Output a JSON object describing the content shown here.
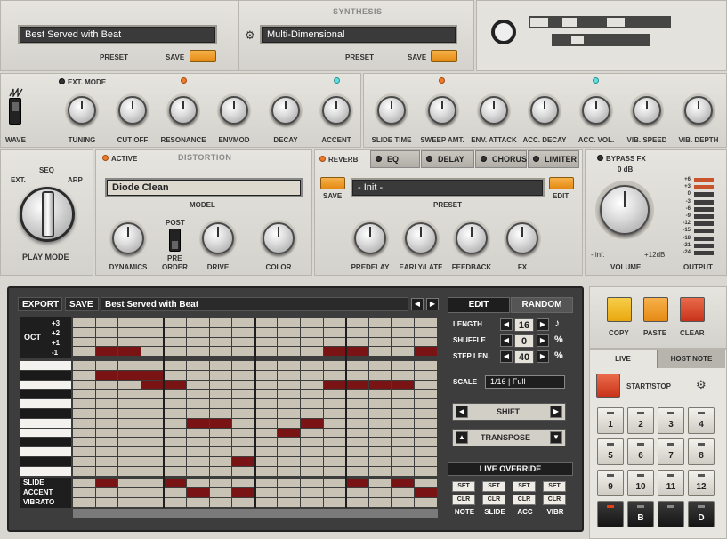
{
  "top": {
    "preset_name": "Best Served with Beat",
    "preset_label": "PRESET",
    "save_label": "SAVE",
    "synthesis_title": "SYNTHESIS",
    "synth_preset_name": "Multi-Dimensional",
    "synth_preset_label": "PRESET",
    "synth_save_label": "SAVE"
  },
  "synth_row": {
    "ext_mode": "EXT. MODE",
    "wave": "WAVE",
    "knobs": [
      "TUNING",
      "CUT OFF",
      "RESONANCE",
      "ENVMOD",
      "DECAY",
      "ACCENT",
      "SLIDE TIME",
      "SWEEP AMT.",
      "ENV. ATTACK",
      "ACC. DECAY",
      "ACC. VOL.",
      "VIB. SPEED",
      "VIB. DEPTH"
    ]
  },
  "play_mode": {
    "options": [
      "EXT.",
      "SEQ",
      "ARP"
    ],
    "label": "PLAY MODE"
  },
  "distortion": {
    "active_label": "ACTIVE",
    "title": "DISTORTION",
    "model_value": "Diode Clean",
    "model_label": "MODEL",
    "post": "POST",
    "pre": "PRE",
    "order": "ORDER",
    "knobs": [
      "DYNAMICS",
      "DRIVE",
      "COLOR"
    ]
  },
  "fx": {
    "tabs": [
      "REVERB",
      "EQ",
      "DELAY",
      "CHORUS",
      "LIMITER"
    ],
    "save_label": "SAVE",
    "preset_value": "- Init -",
    "preset_label": "PRESET",
    "edit_label": "EDIT",
    "knobs": [
      "PREDELAY",
      "EARLY/LATE",
      "FEEDBACK",
      "FX"
    ]
  },
  "output": {
    "bypass": "BYPASS FX",
    "zero_db": "0 dB",
    "minus_inf": "- inf.",
    "plus12": "+12dB",
    "volume": "VOLUME",
    "output": "OUTPUT",
    "meter": [
      "+6",
      "+3",
      "0",
      "-3",
      "-6",
      "-9",
      "-12",
      "-15",
      "-18",
      "-21",
      "-24"
    ]
  },
  "sequencer": {
    "export": "EXPORT",
    "save": "SAVE",
    "pattern_name": "Best Served with Beat",
    "edit": "EDIT",
    "random": "RANDOM",
    "length_label": "LENGTH",
    "length_value": "16",
    "shuffle_label": "SHUFFLE",
    "shuffle_value": "0",
    "shuffle_unit": "%",
    "steplen_label": "STEP LEN.",
    "steplen_value": "40",
    "steplen_unit": "%",
    "scale_label": "SCALE",
    "scale_value": "1/16 | Full",
    "shift": "SHIFT",
    "transpose": "TRANSPOSE",
    "live_override": "LIVE OVERRIDE",
    "override_cols": [
      "NOTE",
      "SLIDE",
      "ACC",
      "VIBR"
    ],
    "set": "SET",
    "clr": "CLR",
    "oct_label": "OCT",
    "oct_values": [
      "+3",
      "+2",
      "+1",
      "-1"
    ],
    "row_labels": [
      "SLIDE",
      "ACCENT",
      "VIBRATO"
    ]
  },
  "right": {
    "copy": "COPY",
    "paste": "PASTE",
    "clear": "CLEAR",
    "live_tab": "LIVE",
    "host_note_tab": "HOST NOTE",
    "start_stop": "START/STOP",
    "pads": [
      "1",
      "2",
      "3",
      "4",
      "5",
      "6",
      "7",
      "8",
      "9",
      "10",
      "11",
      "12"
    ],
    "bottom_pads": [
      "",
      "B",
      "",
      "D"
    ]
  },
  "colors": {
    "accent_orange": "#e58a14",
    "note_on": "#7a1313",
    "copy_yellow": "#f2b51c",
    "clear_red": "#d9432a"
  }
}
